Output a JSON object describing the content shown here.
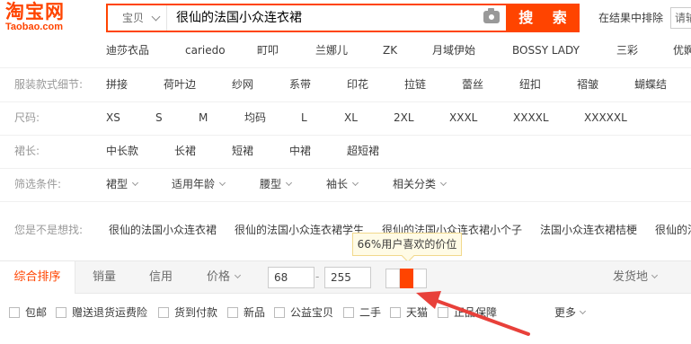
{
  "logo": {
    "cn": "淘宝网",
    "en": "Taobao.com"
  },
  "search": {
    "type": "宝贝",
    "query": "很仙的法国小众连衣裙",
    "button": "搜 索",
    "within": "在结果中排除",
    "within_placeholder": "请输"
  },
  "brands": [
    "迪莎衣品",
    "cariedo",
    "町叩",
    "兰娜儿",
    "ZK",
    "月域伊始",
    "BOSSY LADY",
    "三彩",
    "优婀"
  ],
  "style_detail": {
    "label": "服装款式细节:",
    "options": [
      "拼接",
      "荷叶边",
      "纱网",
      "系带",
      "印花",
      "拉链",
      "蕾丝",
      "纽扣",
      "褶皱",
      "蝴蝶结"
    ]
  },
  "size": {
    "label": "尺码:",
    "options": [
      "XS",
      "S",
      "M",
      "均码",
      "L",
      "XL",
      "2XL",
      "XXXL",
      "XXXXL",
      "XXXXXL"
    ]
  },
  "skirt_length": {
    "label": "裙长:",
    "options": [
      "中长款",
      "长裙",
      "短裙",
      "中裙",
      "超短裙"
    ]
  },
  "filters": {
    "label": "筛选条件:",
    "options": [
      "裙型",
      "适用年龄",
      "腰型",
      "袖长",
      "相关分类"
    ]
  },
  "suggestions": {
    "label": "您是不是想找:",
    "items": [
      "很仙的法国小众连衣裙",
      "很仙的法国小众连衣裙学生",
      "很仙的法国小众连衣裙小个子",
      "法国小众连衣裙桔梗",
      "很仙的法"
    ]
  },
  "sort": {
    "active": "综合排序",
    "sales": "销量",
    "credit": "信用",
    "price": "价格",
    "price_min": "68",
    "price_max": "255",
    "dash": "-",
    "shipping": "发货地"
  },
  "tooltip": "66%用户喜欢的价位",
  "preferred_price_share": 0.66,
  "checkboxes": [
    "包邮",
    "赠送退货运费险",
    "货到付款",
    "新品",
    "公益宝贝",
    "二手",
    "天猫",
    "正品保障"
  ],
  "more": "更多",
  "colors": {
    "accent": "#ff4400",
    "arrow": "#e8403a"
  }
}
